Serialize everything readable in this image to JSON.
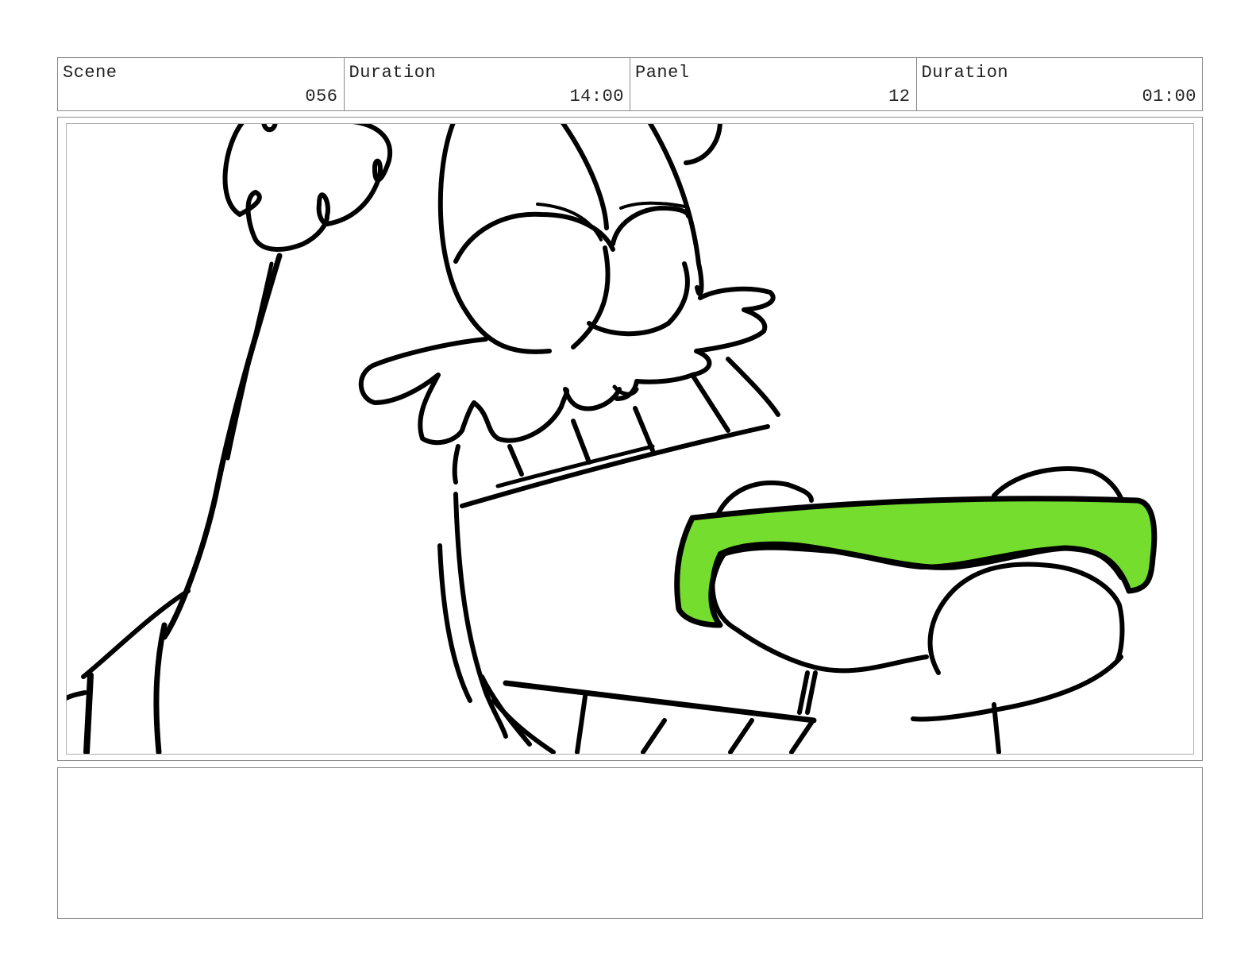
{
  "header": {
    "scene_label": "Scene",
    "scene_value": "056",
    "scene_duration_label": "Duration",
    "scene_duration_value": "14:00",
    "panel_label": "Panel",
    "panel_value": "12",
    "panel_duration_label": "Duration",
    "panel_duration_value": "01:00"
  },
  "drawing": {
    "description_icon": "storyboard-sketch",
    "fill_color": "#74dd2e",
    "stroke_color": "#000000"
  },
  "notes": {
    "text": ""
  }
}
